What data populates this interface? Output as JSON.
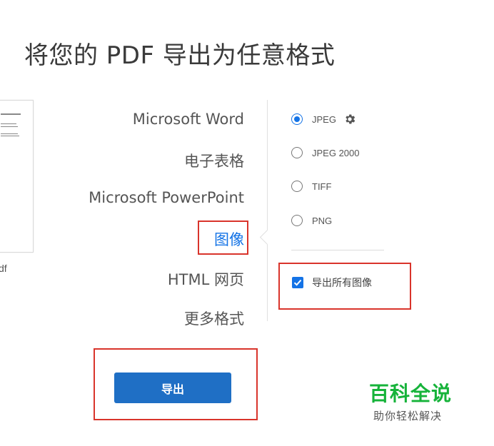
{
  "title": "将您的 PDF 导出为任意格式",
  "thumbnail": {
    "file_suffix": "df"
  },
  "formats": [
    {
      "label": "Microsoft Word"
    },
    {
      "label": "电子表格"
    },
    {
      "label": "Microsoft PowerPoint"
    },
    {
      "label": "图像",
      "selected": true
    },
    {
      "label": "HTML 网页"
    },
    {
      "label": "更多格式"
    }
  ],
  "image_options": {
    "radios": [
      {
        "label": "JPEG",
        "checked": true,
        "has_settings_icon": true
      },
      {
        "label": "JPEG 2000",
        "checked": false
      },
      {
        "label": "TIFF",
        "checked": false
      },
      {
        "label": "PNG",
        "checked": false
      }
    ],
    "export_all_images": {
      "label": "导出所有图像",
      "checked": true
    }
  },
  "export_button": {
    "label": "导出"
  },
  "watermark": {
    "title": "百科全说",
    "subtitle": "助你轻松解决"
  },
  "colors": {
    "accent": "#1473e6",
    "button": "#1f6fc5",
    "highlight": "#d9342b",
    "watermark": "#16b33a"
  }
}
